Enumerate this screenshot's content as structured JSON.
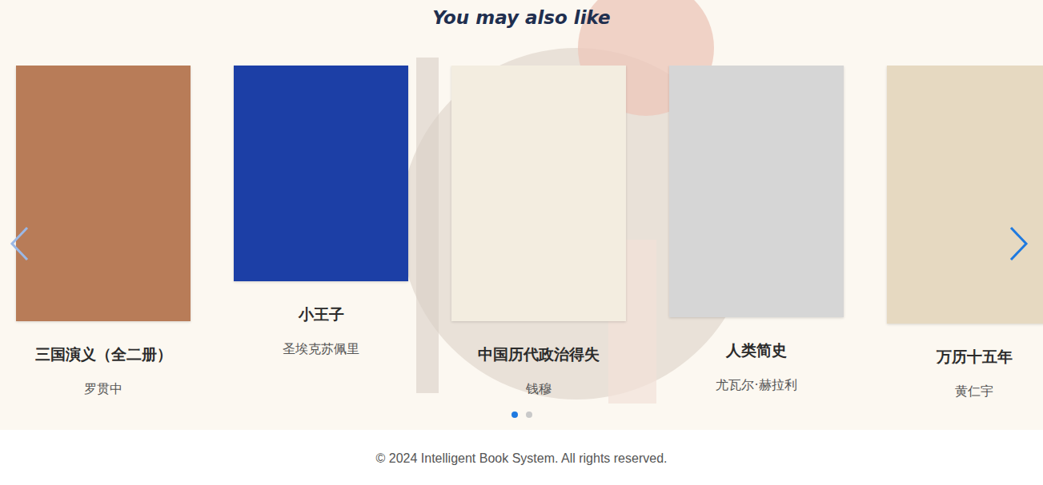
{
  "heading": "You may also like",
  "carousel": {
    "books": [
      {
        "title": "三国演义（全二册）",
        "author": "罗贯中",
        "color": "#b87c58"
      },
      {
        "title": "小王子",
        "author": "圣埃克苏佩里",
        "color": "#1c3fa6"
      },
      {
        "title": "中国历代政治得失",
        "author": "钱穆",
        "color": "#f3ede0"
      },
      {
        "title": "人类简史",
        "author": "尤瓦尔·赫拉利",
        "color": "#d6d6d6"
      },
      {
        "title": "万历十五年",
        "author": "黄仁宇",
        "color": "#e6d9c1"
      }
    ],
    "dots": [
      {
        "selected": true
      },
      {
        "selected": false
      }
    ]
  },
  "footer": "© 2024 Intelligent Book System. All rights reserved."
}
